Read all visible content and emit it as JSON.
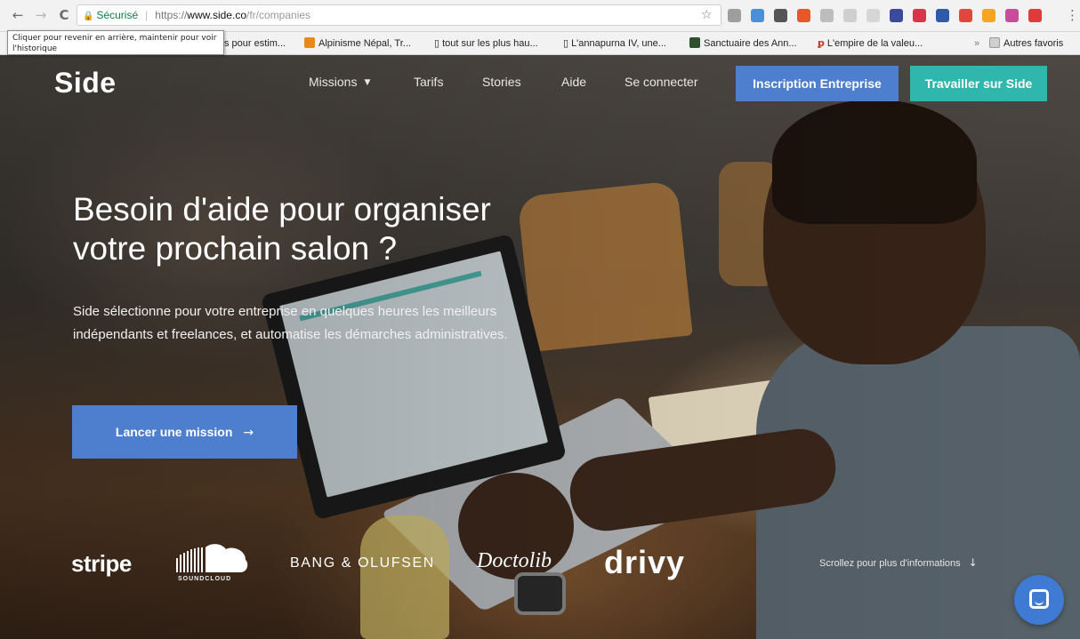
{
  "browser": {
    "nav": {
      "back": "←",
      "forward": "→",
      "reload": "C"
    },
    "address": {
      "secure_label": "Sécurisé",
      "scheme": "https://",
      "host": "www.side.co",
      "path": "/fr/companies"
    },
    "tooltip": "Cliquer pour revenir en arrière, maintenir pour voir l'historique",
    "bookmarks": [
      {
        "label": "s pour estim..."
      },
      {
        "label": "Alpinisme Népal, Tr..."
      },
      {
        "label": "tout sur les plus hau..."
      },
      {
        "label": "L'annapurna IV, une..."
      },
      {
        "label": "Sanctuaire des Ann..."
      },
      {
        "label": "L'empire de la valeu..."
      },
      {
        "label": "Autres favoris"
      }
    ],
    "bookmark_overflow": "»",
    "extension_colors": [
      "#9e9e9e",
      "#4a90d9",
      "#555555",
      "#e8572a",
      "#bdbdbd",
      "#cfcfcf",
      "#d6d6d6",
      "#3b4a9a",
      "#d8344a",
      "#2f5aa8",
      "#e0463b",
      "#f4a623",
      "#c94c9b",
      "#e03b3b"
    ]
  },
  "site": {
    "logo": "Side",
    "nav": {
      "missions": "Missions",
      "tarifs": "Tarifs",
      "stories": "Stories",
      "aide": "Aide",
      "login": "Se connecter"
    },
    "buttons": {
      "company": "Inscription Entreprise",
      "freelancer": "Travailler sur Side"
    },
    "colors": {
      "primary": "#4e7fcf",
      "teal": "#2fb7ae"
    }
  },
  "hero": {
    "title_line1": "Besoin d'aide pour organiser",
    "title_line2": "votre prochain salon ?",
    "description": "Side sélectionne pour votre entreprise en quelques heures les meilleurs indépendants et freelances, et automatise les démarches administratives.",
    "cta": "Lancer une mission"
  },
  "partners": {
    "stripe": "stripe",
    "soundcloud": "SOUNDCLOUD",
    "bang_olufsen": "BANG & OLUFSEN",
    "doctolib": "Doctolib",
    "drivy": "drivy"
  },
  "scroll_hint": "Scrollez pour plus d'informations"
}
